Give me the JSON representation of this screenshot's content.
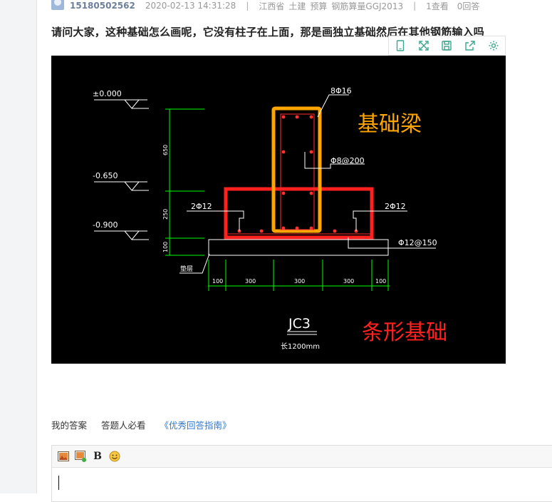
{
  "meta": {
    "username": "15180502562",
    "datetime": "2020-02-13 14:31:28",
    "sep1": "|",
    "location": "江西省",
    "tags": [
      "土建",
      "预算",
      "钢筋算量GGJ2013"
    ],
    "sep2": "|",
    "views": "1查看",
    "answers": "0回答"
  },
  "question": {
    "title": "请问大家，这种基础怎么画呢，它没有柱子在上面，那是画独立基础然后在其他钢筋输入吗"
  },
  "image_toolbar": {
    "icons": [
      "mobile-icon",
      "fullscreen-icon",
      "save-icon",
      "share-icon",
      "settings-icon"
    ]
  },
  "drawing": {
    "elev_0": "±0.000",
    "elev_1": "-0.650",
    "elev_2": "-0.900",
    "rebar_top": "8Φ16",
    "stirrup": "Φ8@200",
    "rebar_left": "2Φ12",
    "rebar_right": "2Φ12",
    "rebar_bottom": "Φ12@150",
    "dim_v1": "650",
    "dim_v2": "250",
    "dim_v3": "100",
    "cushion": "垫层",
    "dims_h": [
      "100",
      "300",
      "300",
      "300",
      "100"
    ],
    "annot_beam": "基础梁",
    "annot_strip": "条形基础",
    "label_name": "JC3",
    "label_width": "长1200mm",
    "colors": {
      "beam": "#ffa500",
      "strip": "#ff2020",
      "green": "#00ff00",
      "rebar": "#ff3030",
      "white": "#ffffff"
    }
  },
  "answer_tabs": {
    "my_answer": "我的答案",
    "must_read": "答题人必看",
    "guide_link": "《优秀回答指南》"
  },
  "editor": {
    "icons": [
      "image-icon",
      "image-upload-icon",
      "bold-icon",
      "emoji-icon"
    ],
    "bold_label": "B"
  }
}
